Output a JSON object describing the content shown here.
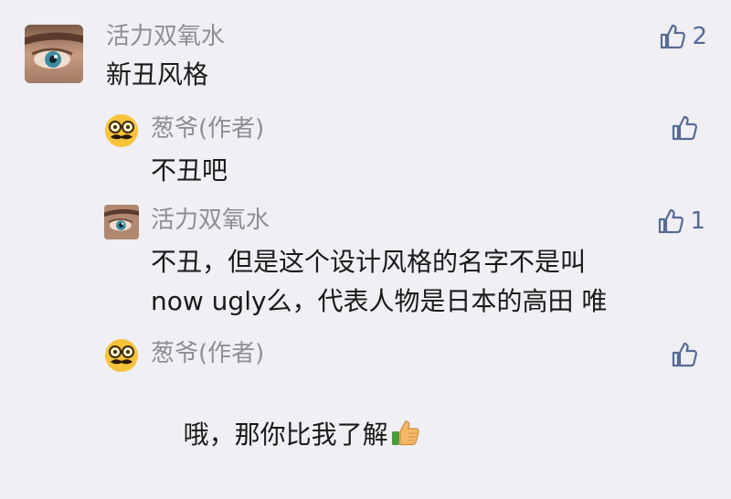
{
  "comments": [
    {
      "author": "活力双氧水",
      "text": "新丑风格",
      "likes": "2",
      "avatar": "photo-eye-avatar"
    },
    {
      "author": "葱爷(作者)",
      "text": "不丑吧",
      "likes": "",
      "avatar": "mustache-glasses-emoji-avatar"
    },
    {
      "author": "活力双氧水",
      "text": "不丑，但是这个设计风格的名字不是叫\nnow ugly么，代表人物是日本的高田 唯",
      "likes": "1",
      "avatar": "photo-eye-avatar"
    },
    {
      "author": "葱爷(作者)",
      "text": "哦，那你比我了解",
      "trailing_emoji": "thumbs-up-emoji",
      "likes": "",
      "avatar": "mustache-glasses-emoji-avatar"
    }
  ],
  "colors": {
    "background": "#efeff4",
    "author": "#8e8e93",
    "like_icon": "#576b95",
    "emoji_face": "#f6c33a"
  }
}
